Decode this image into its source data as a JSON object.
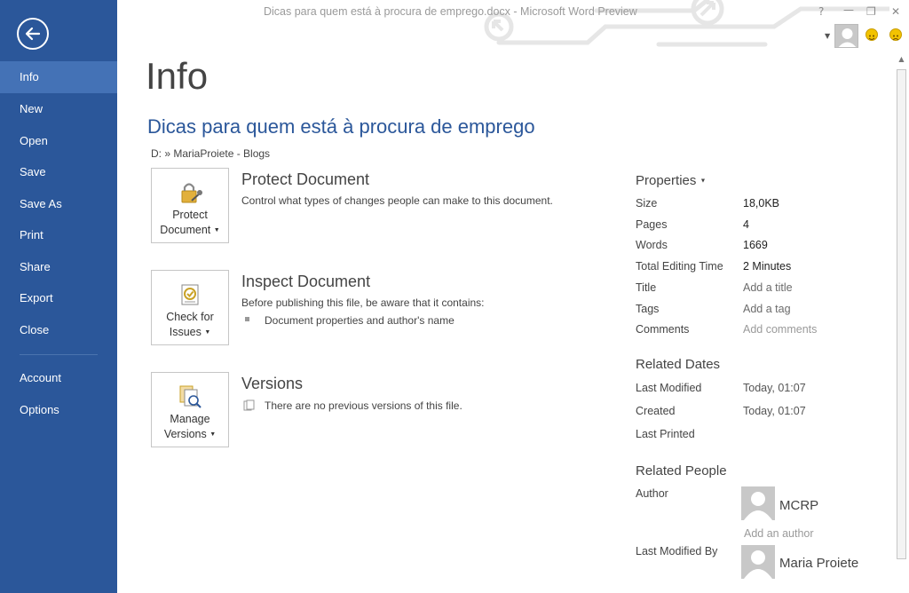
{
  "window": {
    "title": "Dicas para quem está à procura de emprego.docx - Microsoft Word Preview",
    "help": "?",
    "minimize": "—",
    "restore": "❐",
    "close": "✕"
  },
  "sidebar": {
    "back_icon": "back-arrow-icon",
    "items": [
      {
        "label": "Info",
        "active": true
      },
      {
        "label": "New"
      },
      {
        "label": "Open"
      },
      {
        "label": "Save"
      },
      {
        "label": "Save As"
      },
      {
        "label": "Print"
      },
      {
        "label": "Share"
      },
      {
        "label": "Export"
      },
      {
        "label": "Close"
      },
      {
        "label": "Account"
      },
      {
        "label": "Options"
      }
    ]
  },
  "main": {
    "title": "Info",
    "doc_title": "Dicas para quem está à procura de emprego",
    "doc_path": "D: » MariaProiete - Blogs",
    "sections": [
      {
        "button": {
          "line1": "Protect",
          "line2": "Document",
          "icon": "lock-key-icon"
        },
        "heading": "Protect Document",
        "description": "Control what types of changes people can make to this document."
      },
      {
        "button": {
          "line1": "Check for",
          "line2": "Issues",
          "icon": "check-issues-icon"
        },
        "heading": "Inspect Document",
        "description": "Before publishing this file, be aware that it contains:",
        "bullet": "Document properties and author's name"
      },
      {
        "button": {
          "line1": "Manage",
          "line2": "Versions",
          "icon": "manage-versions-icon"
        },
        "heading": "Versions",
        "description": "There are no previous versions of this file."
      }
    ]
  },
  "properties": {
    "heading": "Properties",
    "rows": [
      {
        "label": "Size",
        "value": "18,0KB"
      },
      {
        "label": "Pages",
        "value": "4"
      },
      {
        "label": "Words",
        "value": "1669"
      },
      {
        "label": "Total Editing Time",
        "value": "2 Minutes"
      },
      {
        "label": "Title",
        "value": "Add a title"
      },
      {
        "label": "Tags",
        "value": "Add a tag"
      },
      {
        "label": "Comments",
        "value": "Add comments"
      }
    ],
    "dates_heading": "Related Dates",
    "dates": [
      {
        "label": "Last Modified",
        "value": "Today, 01:07"
      },
      {
        "label": "Created",
        "value": "Today, 01:07"
      },
      {
        "label": "Last Printed",
        "value": ""
      }
    ],
    "people_heading": "Related People",
    "author_label": "Author",
    "author_name": "MCRP",
    "add_author": "Add an author",
    "last_modified_by_label": "Last Modified By",
    "last_modified_by_name": "Maria Proiete"
  },
  "colors": {
    "sidebar": "#2b579a",
    "sidebar_active": "#4472b6",
    "accent_text": "#2b579a"
  }
}
